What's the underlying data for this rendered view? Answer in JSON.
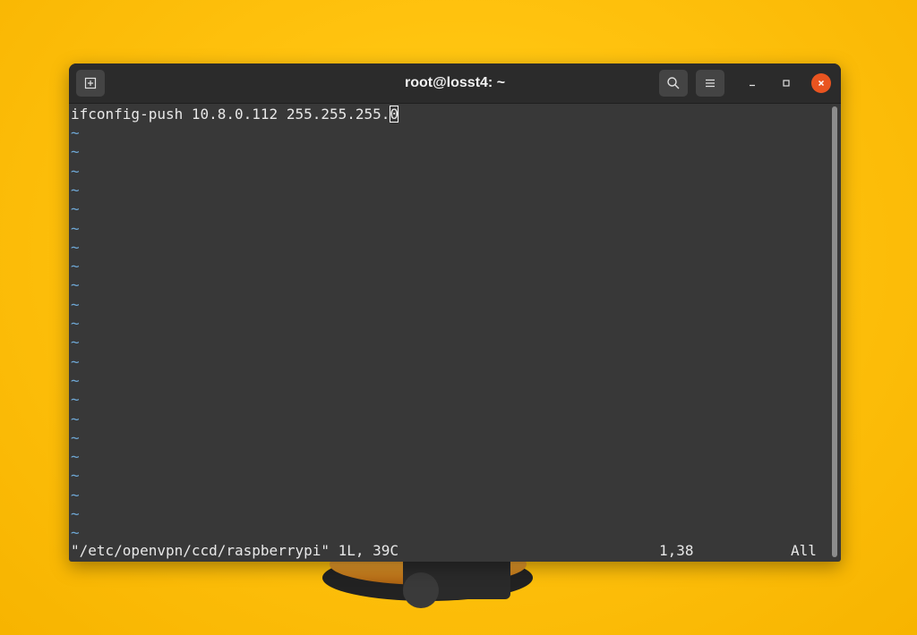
{
  "window": {
    "title": "root@losst4: ~"
  },
  "titlebar": {
    "new_tab_icon": "new-tab-icon",
    "search_icon": "search-icon",
    "menu_icon": "hamburger-menu-icon",
    "minimize_icon": "minimize-icon",
    "maximize_icon": "maximize-icon",
    "close_icon": "close-icon",
    "close_color": "#e95420"
  },
  "editor": {
    "line1_before_cursor": "ifconfig-push 10.8.0.112 255.255.255.",
    "line1_cursor_char": "0",
    "empty_line_marker": "~",
    "empty_line_marker_color": "#6fa8d6",
    "empty_line_count": 22
  },
  "status": {
    "file_info": "\"/etc/openvpn/ccd/raspberrypi\" 1L, 39C",
    "cursor_position": "1,38",
    "view": "All"
  },
  "colors": {
    "background": "#ffc20e",
    "terminal_bg": "#383838",
    "titlebar_bg": "#2b2b2b",
    "text": "#e8e8e8"
  }
}
